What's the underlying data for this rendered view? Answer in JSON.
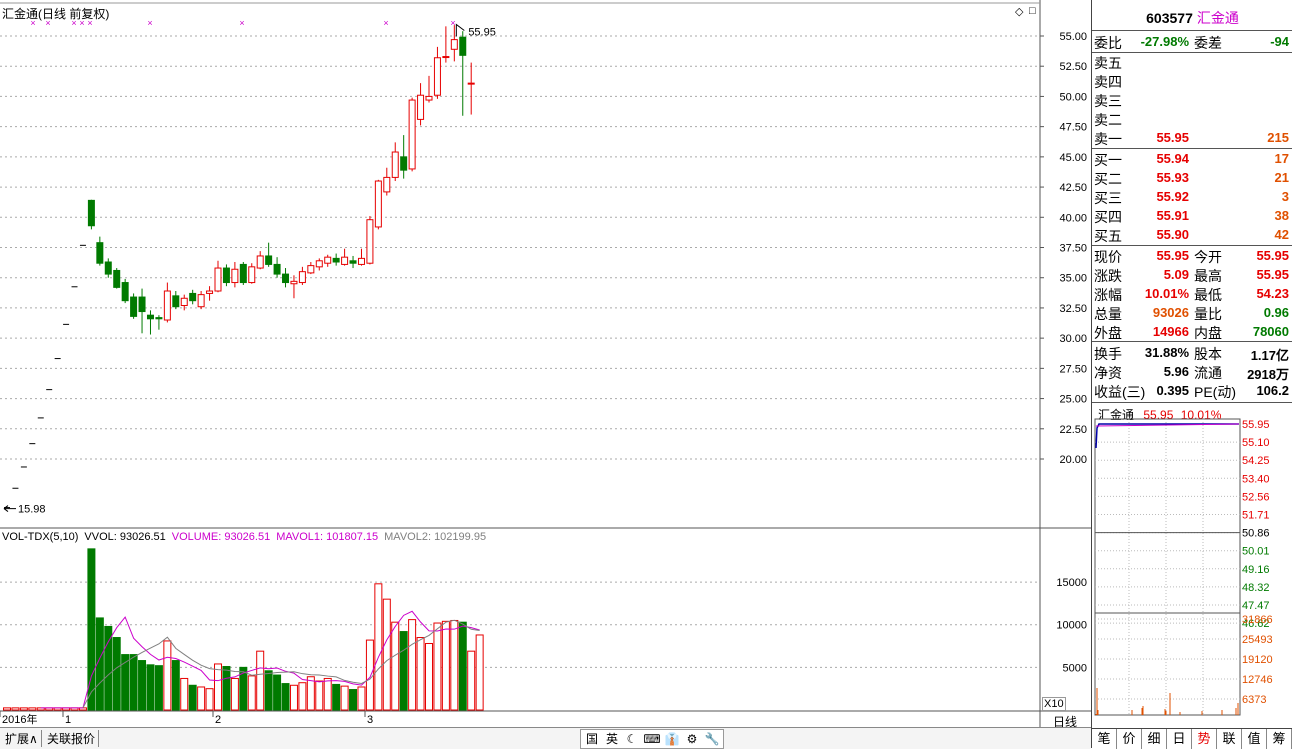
{
  "chart_title": "汇金通(日线 前复权)",
  "controls": {
    "diamond": "◇",
    "square": "□"
  },
  "price_axis_labels": [
    "55.00",
    "52.50",
    "50.00",
    "47.50",
    "45.00",
    "42.50",
    "40.00",
    "37.50",
    "35.00",
    "32.50",
    "30.00",
    "27.50",
    "25.00",
    "22.50",
    "20.00"
  ],
  "volume_axis_labels": [
    "15000",
    "10000",
    "5000"
  ],
  "x_axis_labels": [
    "2016年",
    "1",
    "2",
    "3"
  ],
  "max_marker": "55.95",
  "min_marker": "15.98",
  "volume_legend": {
    "name": "VOL-TDX(5,10)",
    "vvol": "VVOL: 93026.51",
    "volume": "VOLUME: 93026.51",
    "mavol1": "MAVOL1: 101807.15",
    "mavol2": "MAVOL2: 102199.95"
  },
  "colors": {
    "up": "#e60000",
    "down": "#007a00",
    "magenta": "#cc00cc",
    "ma": "#cc00cc"
  },
  "chart_data": {
    "type": "candlestick",
    "title": "汇金通(日线 前复权)",
    "ylim": [
      17.5,
      56
    ],
    "candles": [
      [
        15.98,
        15.98,
        15.98,
        15.98
      ],
      [
        17.58,
        17.58,
        17.58,
        17.58
      ],
      [
        19.34,
        19.34,
        19.34,
        19.34
      ],
      [
        21.27,
        21.27,
        21.27,
        21.27
      ],
      [
        23.4,
        23.4,
        23.4,
        23.4
      ],
      [
        25.74,
        25.74,
        25.74,
        25.74
      ],
      [
        28.31,
        28.31,
        28.31,
        28.31
      ],
      [
        31.14,
        31.14,
        31.14,
        31.14
      ],
      [
        34.25,
        34.25,
        34.25,
        34.25
      ],
      [
        37.68,
        37.68,
        37.68,
        37.68
      ],
      [
        41.4,
        39.3,
        41.45,
        39.0
      ],
      [
        37.9,
        36.2,
        38.4,
        36.0
      ],
      [
        36.3,
        35.3,
        36.6,
        35.0
      ],
      [
        35.6,
        34.2,
        35.8,
        34.1
      ],
      [
        34.6,
        33.1,
        34.9,
        32.9
      ],
      [
        33.4,
        31.8,
        33.7,
        31.6
      ],
      [
        33.4,
        32.2,
        34.1,
        30.4
      ],
      [
        31.9,
        31.6,
        32.3,
        30.3
      ],
      [
        31.7,
        31.6,
        31.9,
        30.7
      ],
      [
        31.5,
        33.9,
        34.6,
        31.3
      ],
      [
        33.5,
        32.6,
        33.9,
        32.4
      ],
      [
        32.7,
        33.3,
        33.6,
        32.3
      ],
      [
        33.7,
        33.1,
        34.0,
        32.8
      ],
      [
        32.6,
        33.6,
        33.9,
        32.4
      ],
      [
        33.7,
        33.9,
        34.3,
        33.1
      ],
      [
        33.9,
        35.8,
        36.4,
        33.8
      ],
      [
        35.8,
        34.6,
        36.1,
        34.3
      ],
      [
        34.6,
        35.7,
        36.3,
        34.2
      ],
      [
        36.1,
        34.6,
        36.3,
        34.4
      ],
      [
        34.6,
        35.9,
        36.2,
        34.5
      ],
      [
        35.8,
        36.8,
        37.2,
        35.7
      ],
      [
        36.8,
        36.1,
        37.9,
        35.9
      ],
      [
        36.1,
        35.3,
        36.7,
        35.0
      ],
      [
        35.3,
        34.6,
        35.8,
        34.2
      ],
      [
        34.5,
        34.7,
        35.2,
        33.3
      ],
      [
        34.6,
        35.5,
        35.9,
        34.4
      ],
      [
        35.4,
        36.0,
        36.3,
        35.3
      ],
      [
        35.9,
        36.4,
        36.6,
        35.6
      ],
      [
        36.2,
        36.7,
        36.9,
        35.9
      ],
      [
        36.6,
        36.3,
        37.0,
        36.0
      ],
      [
        36.1,
        36.7,
        37.4,
        36.0
      ],
      [
        36.4,
        36.2,
        36.8,
        35.8
      ],
      [
        36.1,
        36.6,
        37.4,
        36.0
      ],
      [
        36.2,
        39.8,
        40.1,
        36.1
      ],
      [
        39.2,
        43.0,
        43.1,
        39.0
      ],
      [
        42.1,
        43.3,
        44.1,
        41.8
      ],
      [
        43.3,
        45.4,
        46.2,
        43.0
      ],
      [
        45.0,
        43.9,
        46.8,
        43.2
      ],
      [
        44.0,
        49.7,
        49.9,
        43.8
      ],
      [
        48.1,
        50.1,
        51.1,
        47.6
      ],
      [
        49.7,
        50.0,
        51.7,
        49.5
      ],
      [
        50.1,
        53.2,
        54.1,
        49.8
      ],
      [
        53.3,
        53.3,
        55.8,
        52.8
      ],
      [
        53.9,
        54.7,
        55.9,
        52.9
      ],
      [
        54.9,
        53.4,
        55.4,
        48.4
      ],
      [
        51.1,
        51.1,
        52.8,
        48.5
      ]
    ],
    "volume_ylim": [
      0,
      19000
    ],
    "volumes": [
      250,
      250,
      250,
      250,
      250,
      250,
      250,
      250,
      250,
      250,
      18900,
      10800,
      9800,
      8500,
      6500,
      6500,
      5800,
      5300,
      5200,
      8100,
      5800,
      3700,
      2900,
      2700,
      2500,
      5400,
      5100,
      3700,
      5000,
      4000,
      6900,
      4600,
      4100,
      3100,
      2900,
      3200,
      3900,
      3400,
      3700,
      3000,
      2800,
      2400,
      2700,
      8200,
      14800,
      13000,
      10300,
      9200,
      10600,
      8500,
      7800,
      10200,
      10400,
      10500,
      10300,
      6900,
      8800
    ]
  },
  "right_panel": {
    "code": "603577",
    "name": "汇金通",
    "webi_label": "委比",
    "webi_value": "-27.98%",
    "weicha_label": "委差",
    "weicha_value": "-94",
    "sell": [
      {
        "label": "卖五",
        "price": "",
        "vol": ""
      },
      {
        "label": "卖四",
        "price": "",
        "vol": ""
      },
      {
        "label": "卖三",
        "price": "",
        "vol": ""
      },
      {
        "label": "卖二",
        "price": "",
        "vol": ""
      },
      {
        "label": "卖一",
        "price": "55.95",
        "vol": "215"
      }
    ],
    "buy": [
      {
        "label": "买一",
        "price": "55.94",
        "vol": "17"
      },
      {
        "label": "买二",
        "price": "55.93",
        "vol": "21"
      },
      {
        "label": "买三",
        "price": "55.92",
        "vol": "3"
      },
      {
        "label": "买四",
        "price": "55.91",
        "vol": "38"
      },
      {
        "label": "买五",
        "price": "55.90",
        "vol": "42"
      }
    ],
    "stats": [
      {
        "l1": "现价",
        "v1": "55.95",
        "c1": "red",
        "l2": "今开",
        "v2": "55.95",
        "c2": "red"
      },
      {
        "l1": "涨跌",
        "v1": "5.09",
        "c1": "red",
        "l2": "最高",
        "v2": "55.95",
        "c2": "red"
      },
      {
        "l1": "涨幅",
        "v1": "10.01%",
        "c1": "red",
        "l2": "最低",
        "v2": "54.23",
        "c2": "red"
      },
      {
        "l1": "总量",
        "v1": "93026",
        "c1": "orange",
        "l2": "量比",
        "v2": "0.96",
        "c2": "green"
      },
      {
        "l1": "外盘",
        "v1": "14966",
        "c1": "red",
        "l2": "内盘",
        "v2": "78060",
        "c2": "green"
      }
    ],
    "fund": [
      {
        "l1": "换手",
        "v1": "31.88%",
        "l2": "股本",
        "v2": "1.17亿"
      },
      {
        "l1": "净资",
        "v1": "5.96",
        "l2": "流通",
        "v2": "2918万"
      },
      {
        "l1": "收益(三)",
        "v1": "0.395",
        "l2": "PE(动)",
        "v2": "106.2"
      }
    ],
    "mini_header": {
      "name": "汇金通",
      "price": "55.95",
      "pct": "10.01%"
    },
    "mini_price_labels": [
      "55.95",
      "55.10",
      "54.25",
      "53.40",
      "52.56",
      "51.71",
      "50.86",
      "50.01",
      "49.16",
      "48.32",
      "47.47",
      "46.62"
    ],
    "mini_vol_labels": [
      "31866",
      "25493",
      "19120",
      "12746",
      "6373"
    ],
    "tabs": [
      "笔",
      "价",
      "细",
      "日",
      "势",
      "联",
      "值",
      "筹"
    ]
  },
  "bottom": {
    "tab1": "扩展∧",
    "tab2": "关联报价",
    "period": "日线",
    "x10": "X10",
    "toolbar": [
      "国",
      "英",
      "☾",
      "⌨",
      "👔",
      "⚙",
      "🔧"
    ]
  }
}
